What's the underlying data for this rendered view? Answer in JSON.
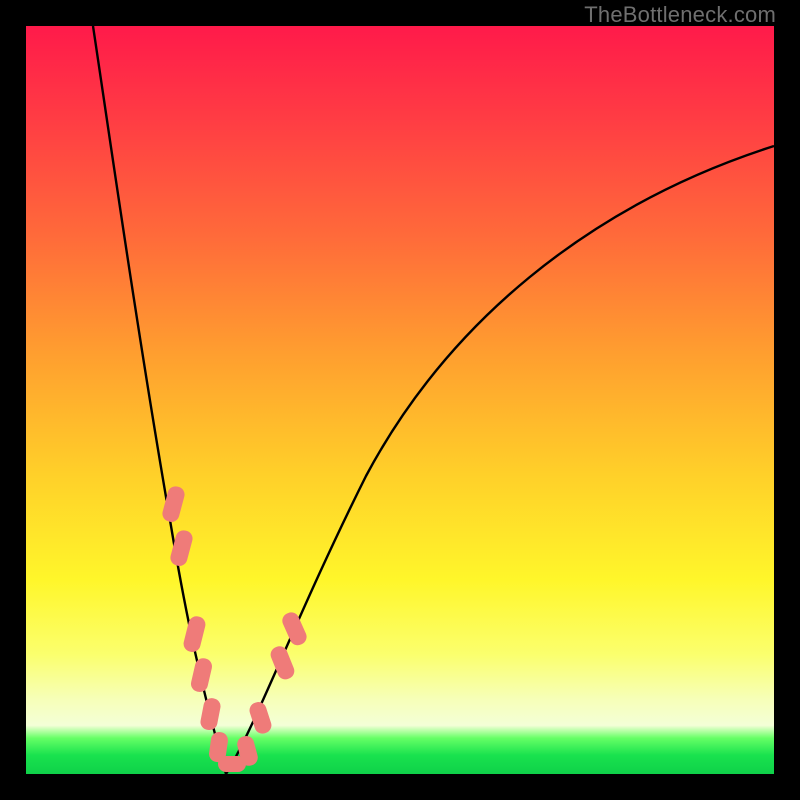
{
  "watermark": "TheBottleneck.com",
  "chart_data": {
    "type": "line",
    "title": "",
    "xlabel": "",
    "ylabel": "",
    "xlim": [
      0,
      100
    ],
    "ylim": [
      0,
      100
    ],
    "background_gradient": {
      "top": "#ff1a4a",
      "mid_upper": "#ff9f2f",
      "mid": "#fff62a",
      "lower": "#f4ffd7",
      "band": "#19e24e"
    },
    "series": [
      {
        "name": "bottleneck-curve",
        "color": "#000000",
        "x": [
          9,
          12,
          15,
          18,
          20,
          22,
          23.7,
          25.5,
          27,
          30,
          35,
          42,
          50,
          58,
          66,
          75,
          85,
          95,
          100
        ],
        "y": [
          100,
          81,
          63,
          46,
          34,
          22,
          12,
          4,
          0,
          4,
          14,
          28,
          42,
          53,
          62,
          70,
          77,
          82,
          84
        ]
      }
    ],
    "markers": {
      "name": "highlight-segments",
      "shape": "rounded-rect",
      "color": "#ef7b79",
      "points_on_curve_x": [
        19.5,
        20.5,
        22.5,
        23.2,
        24.2,
        25.2,
        26.5,
        29.0,
        30.5,
        33.0,
        34.2
      ],
      "approx_y": [
        37,
        31,
        18,
        14,
        9,
        5,
        1,
        3,
        6,
        11,
        14
      ]
    }
  }
}
